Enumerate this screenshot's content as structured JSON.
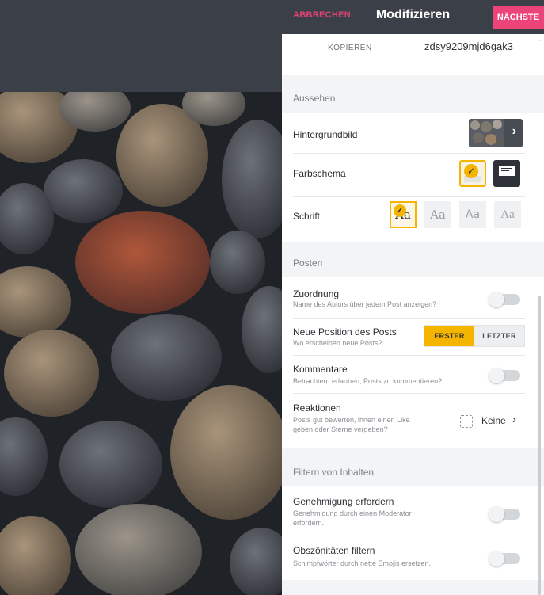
{
  "header": {
    "cancel_label": "ABBRECHEN",
    "title": "Modifizieren",
    "next_label": "NÄCHSTE"
  },
  "link": {
    "copy_label": "KOPIEREN",
    "value": "zdsy9209mjd6gak3"
  },
  "appearance": {
    "section_title": "Aussehen",
    "background_label": "Hintergrundbild",
    "colorscheme_label": "Farbschema",
    "font_label": "Schrift",
    "font_options": [
      "Aa",
      "Aa",
      "Aa",
      "Aa"
    ],
    "selected_font_index": 0,
    "selected_scheme_index": 0
  },
  "posting": {
    "section_title": "Posten",
    "attribution_label": "Zuordnung",
    "attribution_desc": "Name des Autors über jedem Post anzeigen?",
    "attribution_on": false,
    "position_label": "Neue Position des Posts",
    "position_desc": "Wo erscheinen neue Posts?",
    "position_first": "ERSTER",
    "position_last": "LETZTER",
    "position_selected": "ERSTER",
    "comments_label": "Kommentare",
    "comments_desc": "Betrachtern erlauben, Posts zu kommentieren?",
    "comments_on": false,
    "reactions_label": "Reaktionen",
    "reactions_desc_1": "Posts gut bewerten, ihnen einen Like",
    "reactions_desc_2": "geben oder Sterne vergeben?",
    "reactions_value": "Keine"
  },
  "filter": {
    "section_title": "Filtern von Inhalten",
    "approval_label": "Genehmigung erfordern",
    "approval_desc_1": "Genehmigung durch einen Moderator",
    "approval_desc_2": "erfordern.",
    "approval_on": false,
    "profanity_label": "Obszönitäten filtern",
    "profanity_desc": "Schimpfwörter durch nette Emojis ersetzen.",
    "profanity_on": false
  },
  "icons": {
    "chevron": "chevron-right-icon",
    "check": "checkmark-icon",
    "reaction": "dashed-square-icon"
  },
  "colors": {
    "accent_pink": "#ec4478",
    "accent_yellow": "#f4b400",
    "header_bg": "#3b4048"
  }
}
